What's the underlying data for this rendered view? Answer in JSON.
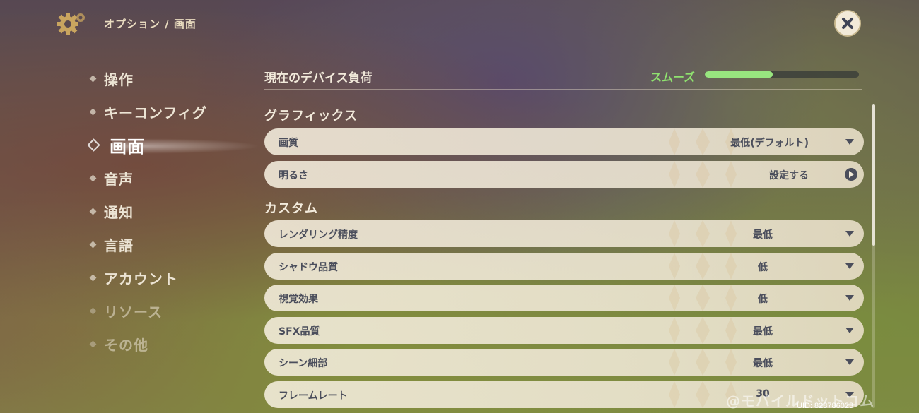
{
  "header": {
    "breadcrumb": "オプション / 画面",
    "gear_icon": "gear-icon",
    "close_icon": "close-icon"
  },
  "sidebar": {
    "items": [
      {
        "label": "操作",
        "active": false
      },
      {
        "label": "キーコンフィグ",
        "active": false
      },
      {
        "label": "画面",
        "active": true
      },
      {
        "label": "音声",
        "active": false
      },
      {
        "label": "通知",
        "active": false
      },
      {
        "label": "言語",
        "active": false
      },
      {
        "label": "アカウント",
        "active": false
      },
      {
        "label": "リソース",
        "active": false
      },
      {
        "label": "その他",
        "active": false
      }
    ]
  },
  "device_load": {
    "title": "現在のデバイス負荷",
    "status": "スムーズ",
    "level_fraction": 0.44,
    "status_color": "#8fe26f"
  },
  "sections": {
    "graphics": "グラフィックス",
    "custom": "カスタム"
  },
  "graphics_settings": [
    {
      "name": "画質",
      "value": "最低(デフォルト)",
      "control": "dropdown"
    },
    {
      "name": "明るさ",
      "value": "設定する",
      "control": "link"
    }
  ],
  "custom_settings": [
    {
      "name": "レンダリング精度",
      "value": "最低",
      "control": "dropdown"
    },
    {
      "name": "シャドウ品質",
      "value": "低",
      "control": "dropdown"
    },
    {
      "name": "視覚効果",
      "value": "低",
      "control": "dropdown"
    },
    {
      "name": "SFX品質",
      "value": "最低",
      "control": "dropdown"
    },
    {
      "name": "シーン細部",
      "value": "最低",
      "control": "dropdown"
    },
    {
      "name": "フレームレート",
      "value": "30",
      "control": "dropdown"
    }
  ],
  "footer": {
    "watermark": "@モバイルドットコム",
    "uid": "UID: 828786023"
  }
}
